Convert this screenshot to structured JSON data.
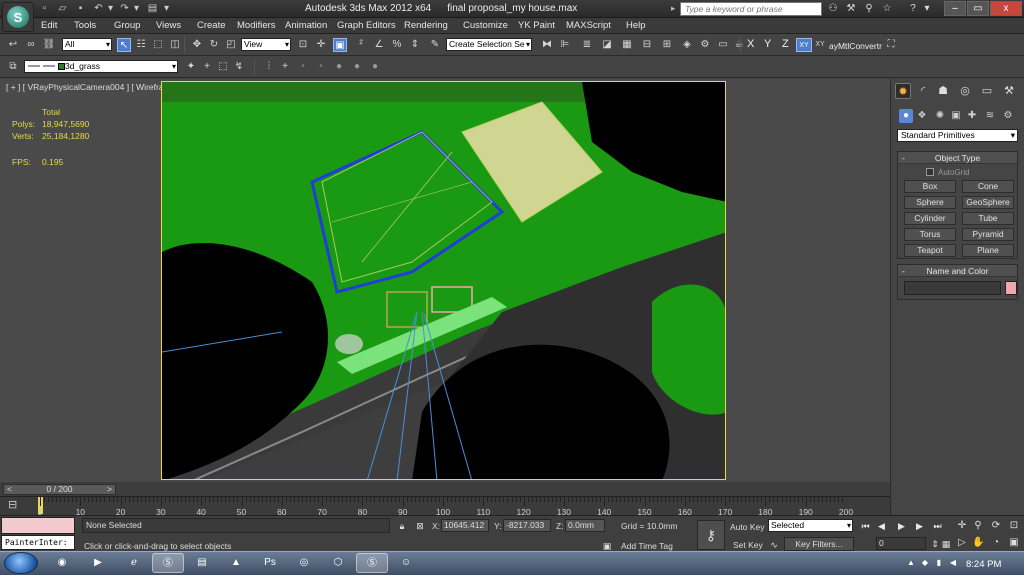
{
  "window": {
    "app_title": "Autodesk 3ds Max  2012 x64",
    "file_name": "final proposal_my house.max",
    "search_placeholder": "Type a keyword or phrase",
    "minimize": "–",
    "restore": "▭",
    "close": "x"
  },
  "menu": [
    "Edit",
    "Tools",
    "Group",
    "Views",
    "Create",
    "Modifiers",
    "Animation",
    "Graph Editors",
    "Rendering",
    "Customize",
    "YK Paint",
    "MAXScript",
    "Help"
  ],
  "toolbar": {
    "selection_filter": "All",
    "ref_coord": "View",
    "selection_set": "Create Selection Se",
    "axes": [
      "X",
      "Y",
      "Z"
    ],
    "axis_plane": "XY",
    "script_button": "ayMtlConvertr"
  },
  "layer_bar": {
    "layer_name": "3d_grass"
  },
  "viewport": {
    "label": "[ + ] [ VRayPhysicalCamera004 ] [ Wireframe ]",
    "stats": {
      "header": "Total",
      "polys_label": "Polys:",
      "polys_value": "18,947,5690",
      "verts_label": "Verts:",
      "verts_value": "25,184,1280",
      "fps_label": "FPS:",
      "fps_value": "0.195"
    },
    "colors": {
      "lawn": "#1a9a12",
      "street": "#3a3a3a",
      "house_outline": "#1f3fd8",
      "house_wire": "#c8d86a",
      "trees_dark": "#000000",
      "camera_lines": "#4a8fd6",
      "frame": "#e8d84a"
    }
  },
  "command_panel": {
    "primitive_type": "Standard Primitives",
    "object_type_title": "Object Type",
    "autogrid_label": "AutoGrid",
    "primitives": [
      "Box",
      "Cone",
      "Sphere",
      "GeoSphere",
      "Cylinder",
      "Tube",
      "Torus",
      "Pyramid",
      "Teapot",
      "Plane"
    ],
    "name_color_title": "Name and Color",
    "object_color": "#f0a6ad"
  },
  "timeline": {
    "frame_left": "<",
    "frame_counter": "0 / 200",
    "frame_right": ">",
    "ticks": [
      "0",
      "10",
      "20",
      "30",
      "40",
      "50",
      "60",
      "70",
      "80",
      "90",
      "100",
      "110",
      "120",
      "130",
      "140",
      "150",
      "160",
      "170",
      "180",
      "190",
      "200"
    ]
  },
  "status_bar": {
    "selection_status": "None Selected",
    "prompt": "Click or click-and-drag to select objects",
    "coord_x_label": "X:",
    "coord_x": "10645.412",
    "coord_y_label": "Y:",
    "coord_y": "-8217.033",
    "coord_z_label": "Z:",
    "coord_z": "0.0mm",
    "grid": "Grid = 10.0mm",
    "add_time_tag": "Add Time Tag",
    "auto_key": "Auto Key",
    "set_key": "Set Key",
    "key_mode": "Selected",
    "key_filters": "Key Filters...",
    "current_frame": "0",
    "listener": "PainterInter:"
  },
  "taskbar": {
    "clock": "8:24 PM"
  }
}
